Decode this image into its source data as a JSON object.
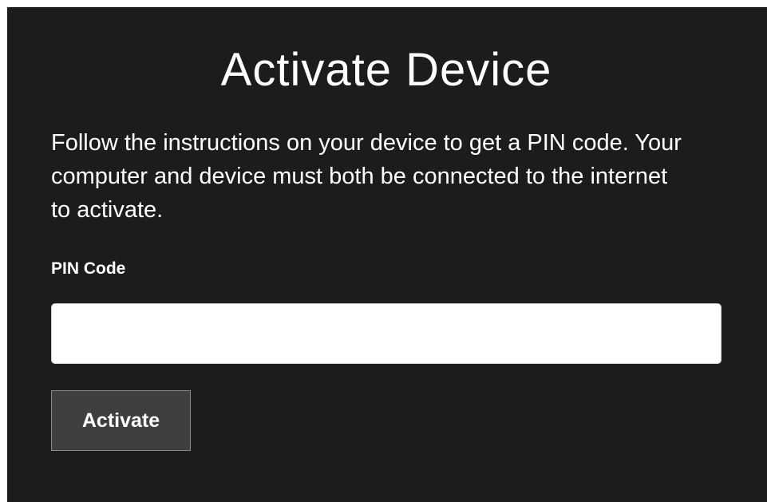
{
  "page": {
    "title": "Activate Device",
    "instructions": "Follow the instructions on your device to get a PIN code. Your computer and device must both be connected to the internet to activate."
  },
  "form": {
    "pin_label": "PIN Code",
    "pin_value": "",
    "pin_placeholder": "",
    "submit_label": "Activate"
  },
  "colors": {
    "panel_background": "#1c1c1c",
    "text": "#ffffff",
    "button_background": "#3f3f3f",
    "button_border": "#8a8a8a",
    "input_background": "#ffffff"
  }
}
